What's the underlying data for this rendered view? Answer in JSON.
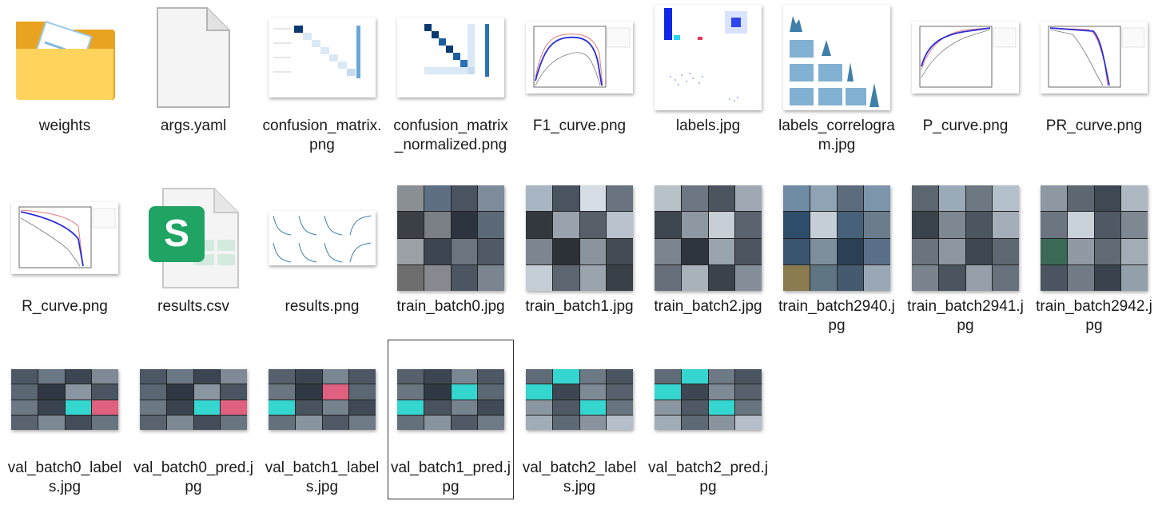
{
  "files": [
    {
      "name": "weights",
      "icon": "folder-icon"
    },
    {
      "name": "args.yaml",
      "icon": "document-icon"
    },
    {
      "name": "confusion_matrix.png",
      "icon": "confusion-matrix-thumbnail"
    },
    {
      "name": "confusion_matrix_normalized.png",
      "icon": "confusion-matrix-normalized-thumbnail"
    },
    {
      "name": "F1_curve.png",
      "icon": "f1-curve-thumbnail"
    },
    {
      "name": "labels.jpg",
      "icon": "labels-thumbnail"
    },
    {
      "name": "labels_correlogram.jpg",
      "icon": "correlogram-thumbnail"
    },
    {
      "name": "P_curve.png",
      "icon": "p-curve-thumbnail"
    },
    {
      "name": "PR_curve.png",
      "icon": "pr-curve-thumbnail"
    },
    {
      "name": "R_curve.png",
      "icon": "r-curve-thumbnail"
    },
    {
      "name": "results.csv",
      "icon": "spreadsheet-icon"
    },
    {
      "name": "results.png",
      "icon": "results-thumbnail"
    },
    {
      "name": "train_batch0.jpg",
      "icon": "photo-mosaic-thumbnail"
    },
    {
      "name": "train_batch1.jpg",
      "icon": "photo-mosaic-thumbnail"
    },
    {
      "name": "train_batch2.jpg",
      "icon": "photo-mosaic-thumbnail"
    },
    {
      "name": "train_batch2940.jpg",
      "icon": "photo-mosaic-thumbnail"
    },
    {
      "name": "train_batch2941.jpg",
      "icon": "photo-mosaic-thumbnail"
    },
    {
      "name": "train_batch2942.jpg",
      "icon": "photo-mosaic-thumbnail"
    },
    {
      "name": "val_batch0_labels.jpg",
      "icon": "photo-mosaic-thumbnail"
    },
    {
      "name": "val_batch0_pred.jpg",
      "icon": "photo-mosaic-thumbnail"
    },
    {
      "name": "val_batch1_labels.jpg",
      "icon": "photo-mosaic-thumbnail"
    },
    {
      "name": "val_batch1_pred.jpg",
      "icon": "photo-mosaic-thumbnail",
      "selected": true
    },
    {
      "name": "val_batch2_labels.jpg",
      "icon": "photo-mosaic-thumbnail"
    },
    {
      "name": "val_batch2_pred.jpg",
      "icon": "photo-mosaic-thumbnail"
    }
  ],
  "colors": {
    "folder": "#f3b52e",
    "folder_front": "#ffd966",
    "spreadsheet": "#1fa463",
    "plot_line": "#2a2ad8",
    "selection_border": "#333333"
  }
}
